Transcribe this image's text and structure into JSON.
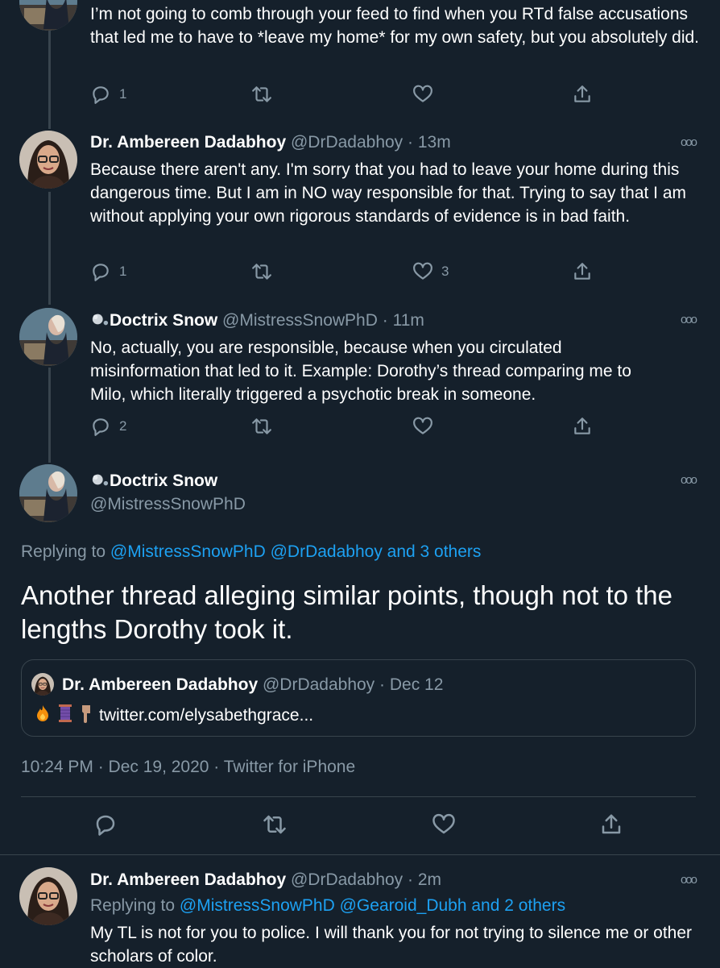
{
  "tweet1": {
    "text": "I’m not going to comb through your feed to find when you RTd false accusations that led me to have to *leave my home* for my own safety, but you absolutely did.",
    "reply_count": "1",
    "retweet_count": "",
    "like_count": ""
  },
  "tweet2": {
    "name": "Dr. Ambereen Dadabhoy",
    "handle": "@DrDadabhoy",
    "time": "· 13m",
    "text": "Because there aren't any. I'm sorry that you had to leave your home during this dangerous time. But I am in NO way responsible for that. Trying to say that I am without applying your own rigorous standards of evidence is in bad faith.",
    "reply_count": "1",
    "like_count": "3"
  },
  "tweet3": {
    "name": "Doctrix Snow",
    "handle": "@MistressSnowPhD",
    "time": "· 11m",
    "text": "No, actually, you are responsible, because when you circulated misinformation that led to it. Example: Dorothy’s thread comparing me to Milo, which literally triggered a psychotic break in someone.",
    "reply_count": "2"
  },
  "main_tweet": {
    "name": "Doctrix Snow",
    "handle": "@MistressSnowPhD",
    "replying_prefix": "Replying to",
    "replying_to": "@MistressSnowPhD @DrDadabhoy and 3 others",
    "text": "Another thread alleging similar points, though not to the lengths Dorothy took it.",
    "quote": {
      "name": "Dr. Ambereen Dadabhoy",
      "handle": "@DrDadabhoy",
      "time": "· Dec 12",
      "link": "twitter.com/elysabethgrace..."
    },
    "timestamp": "10:24 PM · Dec 19, 2020 · Twitter for iPhone"
  },
  "reply_tweet": {
    "name": "Dr. Ambereen Dadabhoy",
    "handle": "@DrDadabhoy",
    "time": "· 2m",
    "replying_prefix": "Replying to",
    "replying_to": "@MistressSnowPhD @Gearoid_Dubh and 2 others",
    "text": "My TL is not for you to police. I will thank you for not trying to silence me or other scholars of color."
  },
  "more_glyph": "ooo",
  "icons": [
    "reply-icon",
    "retweet-icon",
    "like-icon",
    "share-icon",
    "more-icon",
    "snowflake-icon"
  ],
  "colors": {
    "background": "#15202b",
    "link": "#1da1f2",
    "muted": "#8899a6",
    "divider": "#38444d"
  }
}
